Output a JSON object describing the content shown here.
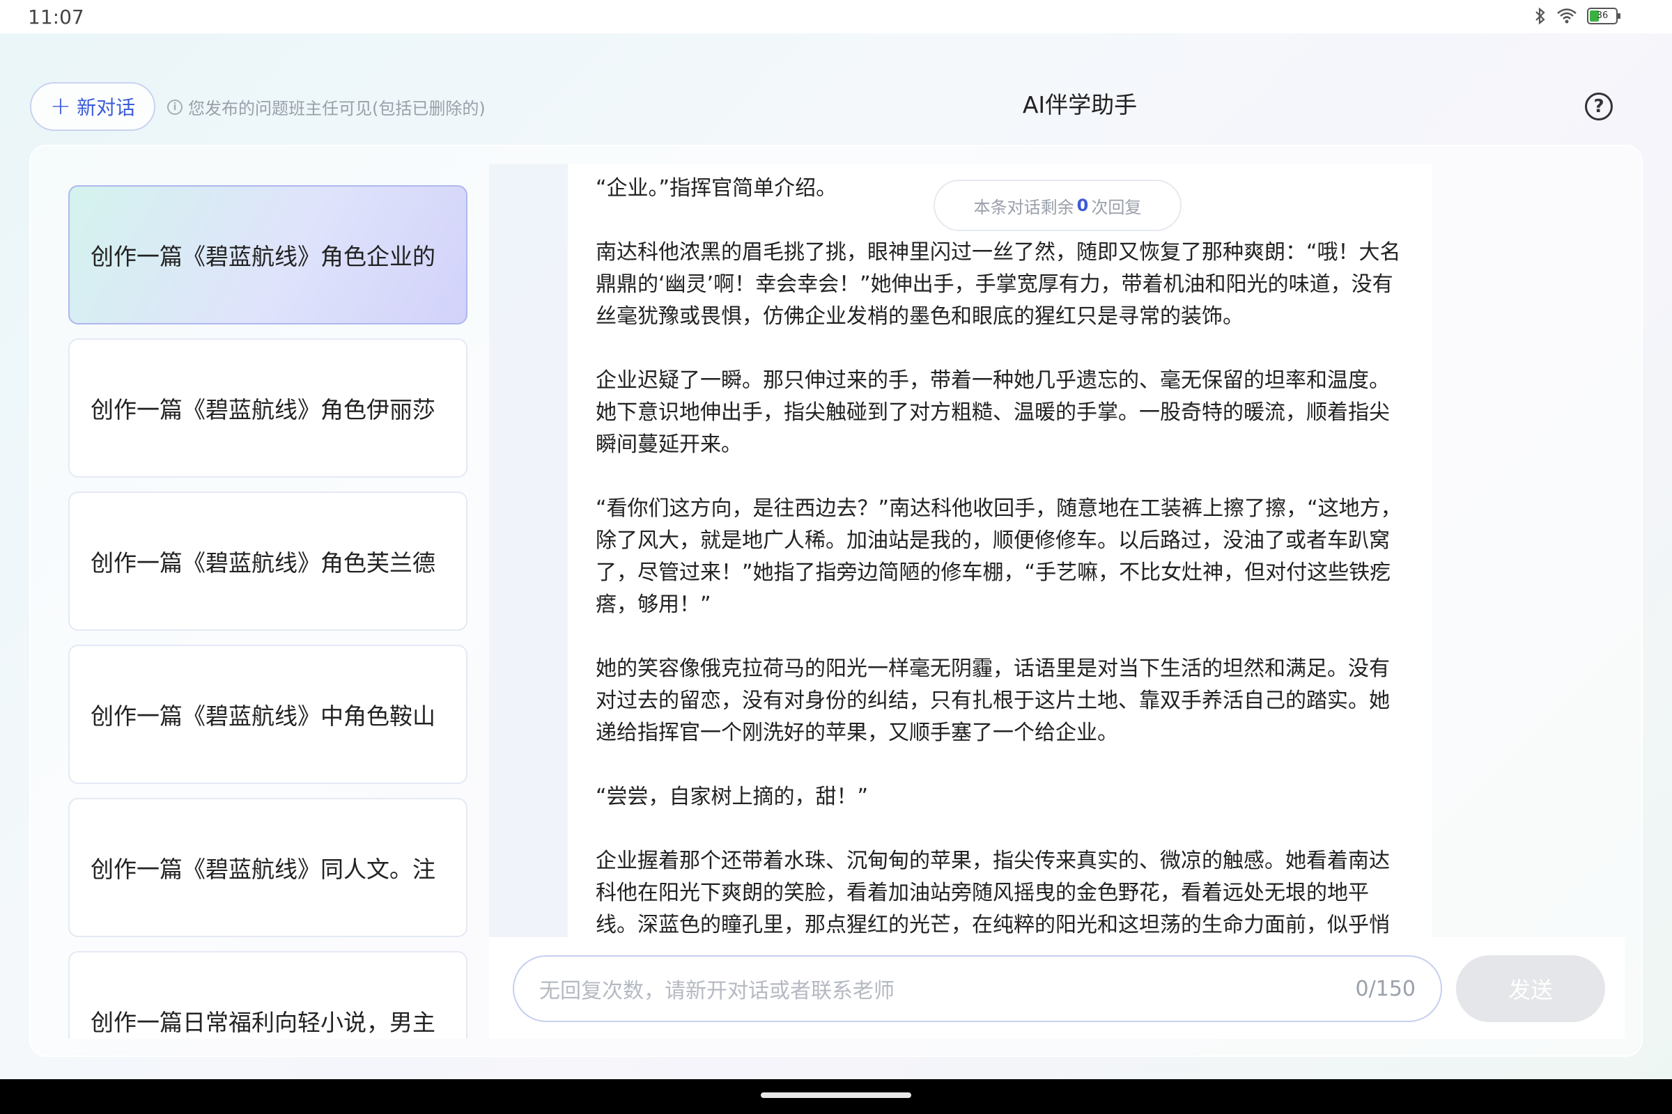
{
  "status_bar": {
    "time": "11:07",
    "battery_level": "36",
    "battery_fraction": 0.36,
    "icons": [
      "bluetooth-icon",
      "wifi-icon",
      "battery-icon"
    ]
  },
  "header": {
    "new_chat_label": "新对话",
    "notice": "您发布的问题班主任可见(包括已删除的)",
    "title": "AI伴学助手",
    "help_symbol": "?"
  },
  "sidebar": {
    "items": [
      {
        "label": "创作一篇《碧蓝航线》角色企业的",
        "active": true
      },
      {
        "label": "创作一篇《碧蓝航线》角色伊丽莎",
        "active": false
      },
      {
        "label": "创作一篇《碧蓝航线》角色芙兰德",
        "active": false
      },
      {
        "label": "创作一篇《碧蓝航线》中角色鞍山",
        "active": false
      },
      {
        "label": "创作一篇《碧蓝航线》同人文。注",
        "active": false
      },
      {
        "label": "创作一篇日常福利向轻小说，男主",
        "active": false
      }
    ]
  },
  "chat": {
    "remaining_prefix": "本条对话剩余",
    "remaining_count": "0",
    "remaining_suffix": "次回复",
    "paragraphs": [
      "“企业。”指挥官简单介绍。",
      "南达科他浓黑的眉毛挑了挑，眼神里闪过一丝了然，随即又恢复了那种爽朗：“哦！大名鼎鼎的‘幽灵’啊！幸会幸会！”她伸出手，手掌宽厚有力，带着机油和阳光的味道，没有丝毫犹豫或畏惧，仿佛企业发梢的墨色和眼底的猩红只是寻常的装饰。",
      "企业迟疑了一瞬。那只伸过来的手，带着一种她几乎遗忘的、毫无保留的坦率和温度。她下意识地伸出手，指尖触碰到了对方粗糙、温暖的手掌。一股奇特的暖流，顺着指尖瞬间蔓延开来。",
      "“看你们这方向，是往西边去？”南达科他收回手，随意地在工装裤上擦了擦，“这地方，除了风大，就是地广人稀。加油站是我的，顺便修修车。以后路过，没油了或者车趴窝了，尽管过来！”她指了指旁边简陋的修车棚，“手艺嘛，不比女灶神，但对付这些铁疙瘩，够用！”",
      "她的笑容像俄克拉荷马的阳光一样毫无阴霾，话语里是对当下生活的坦然和满足。没有对过去的留恋，没有对身份的纠结，只有扎根于这片土地、靠双手养活自己的踏实。她递给指挥官一个刚洗好的苹果，又顺手塞了一个给企业。",
      "“尝尝，自家树上摘的，甜！”",
      "企业握着那个还带着水珠、沉甸甸的苹果，指尖传来真实的、微凉的触感。她看着南达科他在阳光下爽朗的笑脸，看着加油站旁随风摇曳的金色野花，看着远处无垠的地平线。深蓝色的瞳孔里，那点猩红的光芒，在纯粹的阳光和这坦荡的生命力面前，似乎悄"
    ]
  },
  "input": {
    "placeholder": "无回复次数，请新开对话或者联系老师",
    "counter": "0/150",
    "send_label": "发送"
  },
  "colors": {
    "accent": "#3b5bd8",
    "active_item_gradient_start": "#d4f3ee",
    "active_item_gradient_end": "#d2d2fa",
    "send_disabled": "#e5e6e9"
  }
}
